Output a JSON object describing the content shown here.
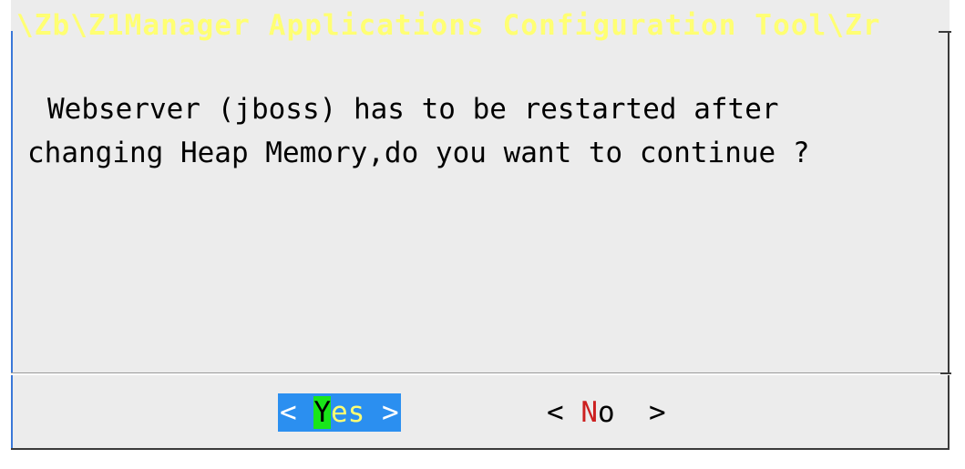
{
  "dialog": {
    "title": "\\Zb\\Z1Manager Applications Configuration Tool\\Zr",
    "message_line1": "Webserver (jboss) has to be restarted after",
    "message_line2": "changing Heap Memory,do you want to continue ?",
    "buttons": {
      "yes": {
        "open": "< ",
        "hotkey": "Y",
        "rest": "es",
        "close": " >"
      },
      "no": {
        "open": "< ",
        "hotkey": "N",
        "rest": "o",
        "close": "  >"
      }
    }
  },
  "colors": {
    "dialog_bg": "#ececec",
    "title": "#ffff73",
    "selected_button_bg": "#2b8ff0",
    "hotkey_selected_bg": "#19e619",
    "hotkey_unselected": "#cc1f1f"
  }
}
